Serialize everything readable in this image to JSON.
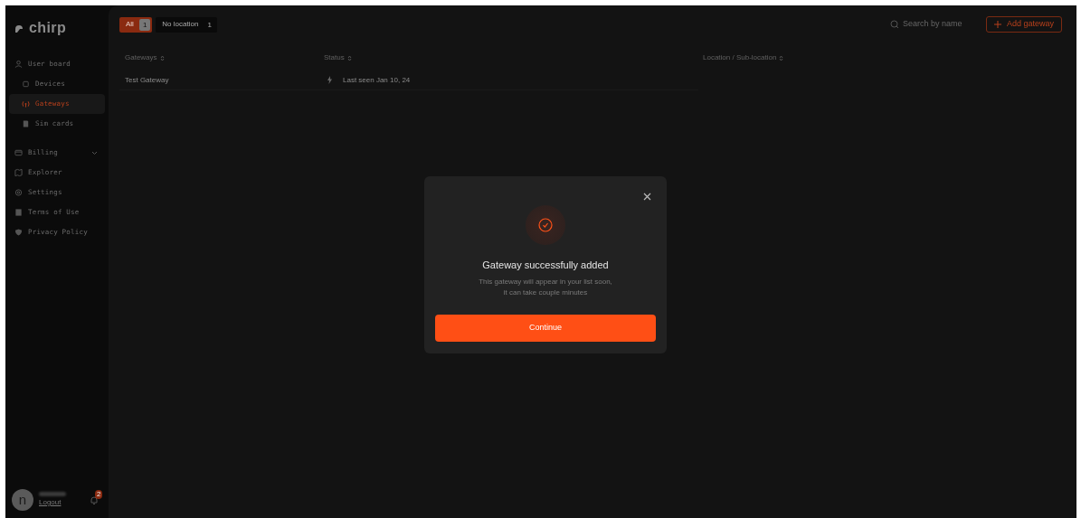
{
  "sidebar": {
    "logo": "chirp",
    "items": [
      {
        "label": "User board",
        "selected": false
      },
      {
        "label": "Devices",
        "selected": false
      },
      {
        "label": "Gateways",
        "selected": true
      },
      {
        "label": "Sim cards",
        "selected": false
      },
      {
        "label": "Billing",
        "selected": false
      },
      {
        "label": "Explorer",
        "selected": false
      },
      {
        "label": "Settings",
        "selected": false
      },
      {
        "label": "Terms of Use",
        "selected": false
      },
      {
        "label": "Privacy Policy",
        "selected": false
      }
    ],
    "user": {
      "avatar": "n",
      "link": "Logout",
      "notifications": "2"
    }
  },
  "filters": [
    {
      "label": "All",
      "count": "1",
      "selected": true
    },
    {
      "label": "No location",
      "count": "1",
      "selected": false
    }
  ],
  "search": {
    "placeholder": "Search by name"
  },
  "add_button": "Add gateway",
  "table": {
    "columns": [
      "Gateways",
      "Status",
      "Location / Sub-location"
    ],
    "rows": [
      {
        "name": "Test Gateway",
        "status": "Last seen Jan 10, 24"
      }
    ]
  },
  "dialog": {
    "title": "Gateway successfully added",
    "message": "This gateway will appear in your list soon,\nit can take couple minutes",
    "button": "Continue"
  }
}
